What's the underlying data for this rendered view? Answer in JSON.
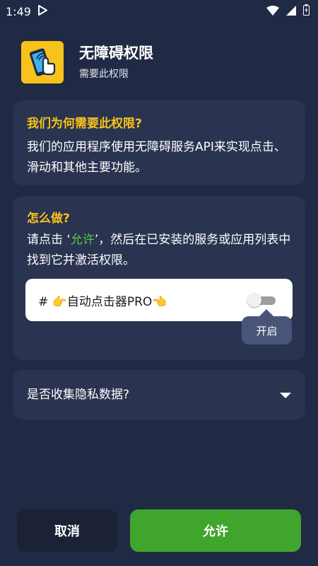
{
  "status_bar": {
    "time": "1:49"
  },
  "header": {
    "title": "无障碍权限",
    "subtitle": "需要此权限"
  },
  "why_card": {
    "title": "我们为何需要此权限?",
    "body": "我们的应用程序使用无障碍服务API来实现点击、滑动和其他主要功能。"
  },
  "how_card": {
    "title": "怎么做?",
    "body_before": "请点击 ‘",
    "body_highlight": "允许",
    "body_after": "’，然后在已安装的服务或应用列表中找到它并激活权限。",
    "service_name": "# 👉自动点击器PRO👈",
    "toggle_on": false,
    "tooltip": "开启"
  },
  "privacy": {
    "label": "是否收集隐私数据?"
  },
  "buttons": {
    "cancel": "取消",
    "allow": "允许"
  },
  "colors": {
    "accent_yellow": "#f7c21b",
    "accent_green": "#5cc74a",
    "allow_button": "#3fa52c",
    "background": "#212a44",
    "card": "#2a3350"
  }
}
